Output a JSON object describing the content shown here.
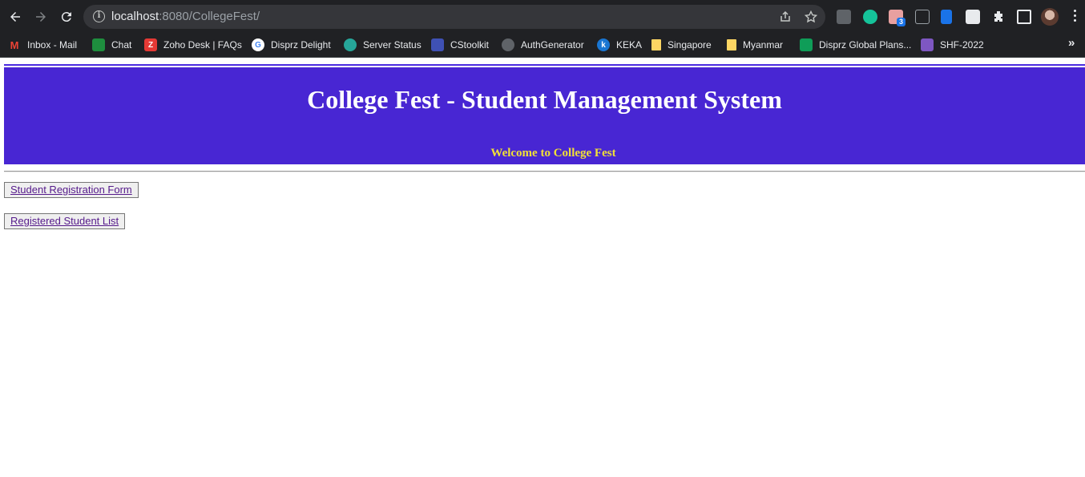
{
  "browser": {
    "url_host": "localhost",
    "url_rest": ":8080/CollegeFest/",
    "bookmarks": [
      {
        "label": "Inbox - Mail",
        "icon": "gmail-icon",
        "color": "#ea4335"
      },
      {
        "label": "Chat",
        "icon": "chat-icon",
        "color": "#1e8e3e"
      },
      {
        "label": "Zoho Desk | FAQs",
        "icon": "zoho-icon",
        "color": "#e53935"
      },
      {
        "label": "Disprz Delight",
        "icon": "google-icon",
        "color": "#ffffff"
      },
      {
        "label": "Server Status",
        "icon": "server-status-icon",
        "color": "#26a69a"
      },
      {
        "label": "CStoolkit",
        "icon": "cstoolkit-icon",
        "color": "#3f51b5"
      },
      {
        "label": "AuthGenerator",
        "icon": "globe-icon",
        "color": "#5f6368"
      },
      {
        "label": "KEKA",
        "icon": "keka-icon",
        "color": "#1976d2"
      },
      {
        "label": "Singapore",
        "icon": "sticky-note-icon",
        "color": "#fdd663"
      },
      {
        "label": "Myanmar",
        "icon": "sticky-note-icon",
        "color": "#fdd663"
      },
      {
        "label": "Disprz Global Plans...",
        "icon": "sheets-icon",
        "color": "#0f9d58"
      },
      {
        "label": "SHF-2022",
        "icon": "list-icon",
        "color": "#7e57c2"
      }
    ],
    "extension_badge": "3"
  },
  "page": {
    "title": "College Fest - Student Management System",
    "welcome": "Welcome to College Fest",
    "links": [
      {
        "label": "Student Registration Form"
      },
      {
        "label": "Registered Student List"
      }
    ]
  }
}
